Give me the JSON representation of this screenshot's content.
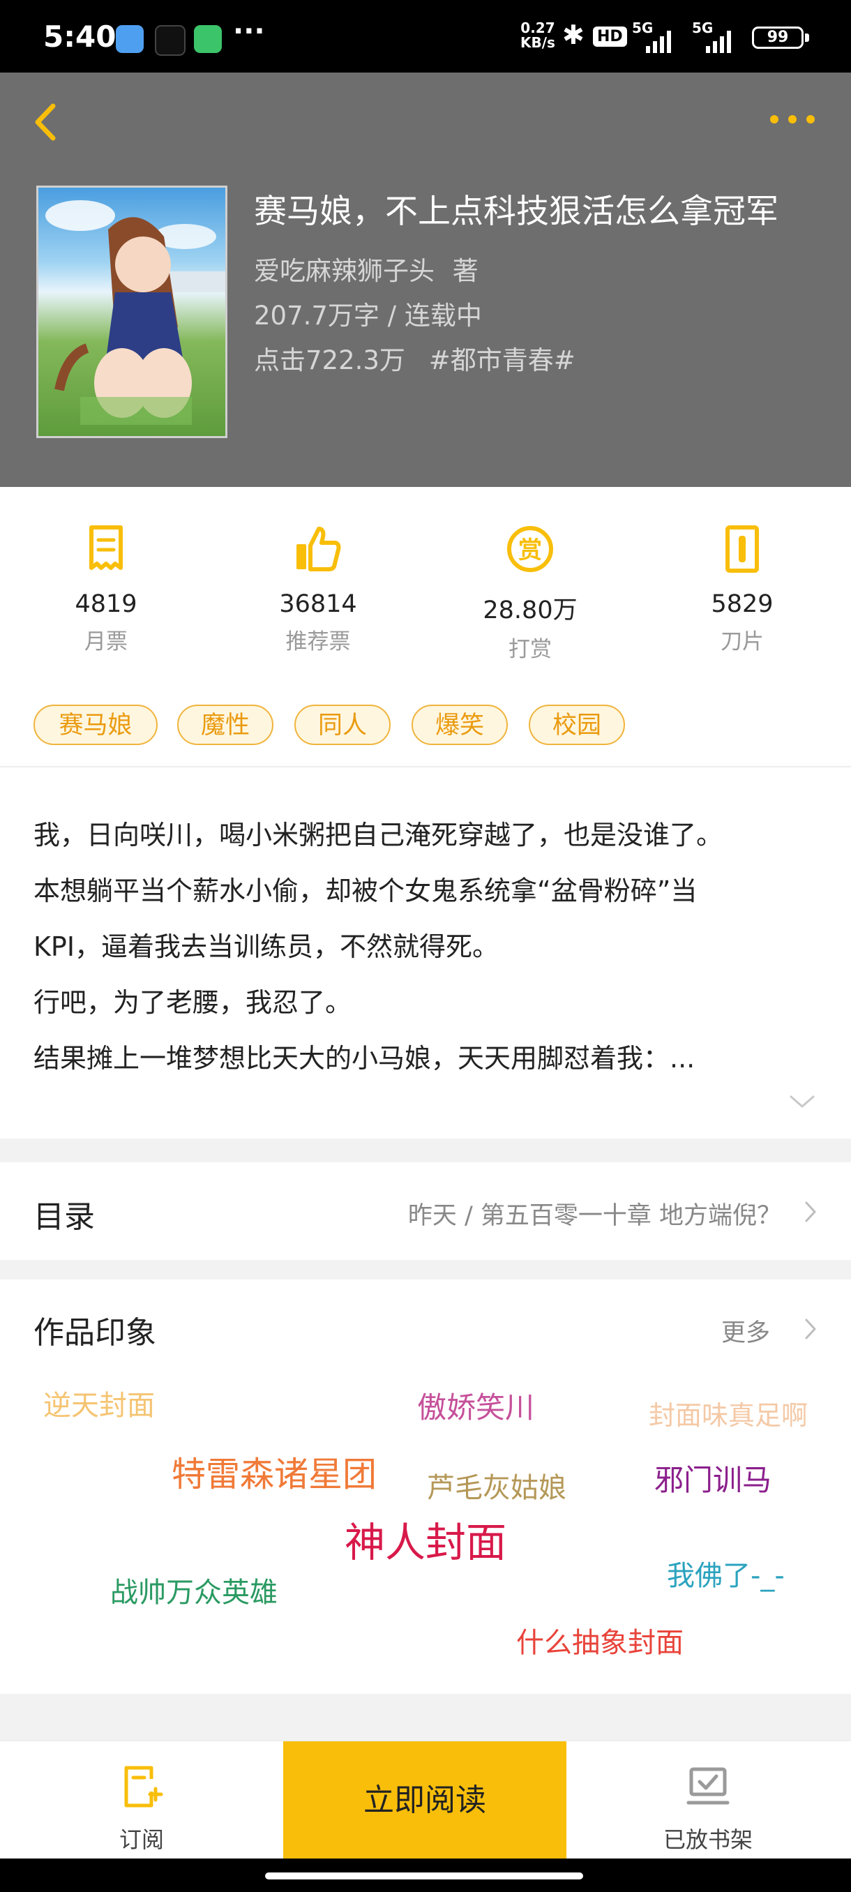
{
  "status_bar": {
    "time": "5:40",
    "more": "···",
    "net_speed": "0.27",
    "net_unit": "KB/s",
    "hd_badge": "HD",
    "signal_1": "5G",
    "signal_2": "5G",
    "battery": "99",
    "app_icons": [
      "weather-icon",
      "tiktok-icon",
      "app-icon"
    ]
  },
  "header": {
    "book_title": "赛马娘，不上点科技狠活怎么拿冠军",
    "author": "爱吃麻辣狮子头",
    "author_suffix": "著",
    "word_count_status": "207.7万字 / 连载中",
    "clicks": "点击722.3万",
    "category": "#都市青春#"
  },
  "stats": [
    {
      "icon": "monthly-ticket-icon",
      "value": "4819",
      "label": "月票"
    },
    {
      "icon": "thumbs-up-icon",
      "value": "36814",
      "label": "推荐票"
    },
    {
      "icon": "reward-icon",
      "value": "28.80万",
      "label": "打赏"
    },
    {
      "icon": "blade-icon",
      "value": "5829",
      "label": "刀片"
    }
  ],
  "tags": [
    "赛马娘",
    "魔性",
    "同人",
    "爆笑",
    "校园"
  ],
  "synopsis": [
    "我，日向咲川，喝小米粥把自己淹死穿越了，也是没谁了。",
    "本想躺平当个薪水小偷，却被个女鬼系统拿“盆骨粉碎”当",
    "KPI，逼着我去当训练员，不然就得死。",
    "行吧，为了老腰，我忍了。",
    "结果摊上一堆梦想比天大的小马娘，天天用脚怼着我：..."
  ],
  "catalog": {
    "label": "目录",
    "latest": "昨天 / 第五百零一十章 地方端倪？"
  },
  "impressions": {
    "heading": "作品印象",
    "more": "更多",
    "words": [
      {
        "text": "逆天封面",
        "color": "#f5c472"
      },
      {
        "text": "傲娇笑川",
        "color": "#c5509a"
      },
      {
        "text": "封面味真足啊",
        "color": "#f4c9a6"
      },
      {
        "text": "特雷森诸星团",
        "color": "#f07a38"
      },
      {
        "text": "芦毛灰姑娘",
        "color": "#b59858"
      },
      {
        "text": "邪门训马",
        "color": "#8b1f8c"
      },
      {
        "text": "神人封面",
        "color": "#d8194a"
      },
      {
        "text": "我佛了-_-",
        "color": "#2ba3be"
      },
      {
        "text": "战帅万众英雄",
        "color": "#2a9a62"
      },
      {
        "text": "什么抽象封面",
        "color": "#e8433a"
      }
    ]
  },
  "bottom_bar": {
    "subscribe": "订阅",
    "read_now": "立即阅读",
    "on_shelf": "已放书架"
  },
  "colors": {
    "accent": "#f8be0a",
    "header_bg": "#6e6e6e",
    "tag_border": "#f0b43c"
  }
}
